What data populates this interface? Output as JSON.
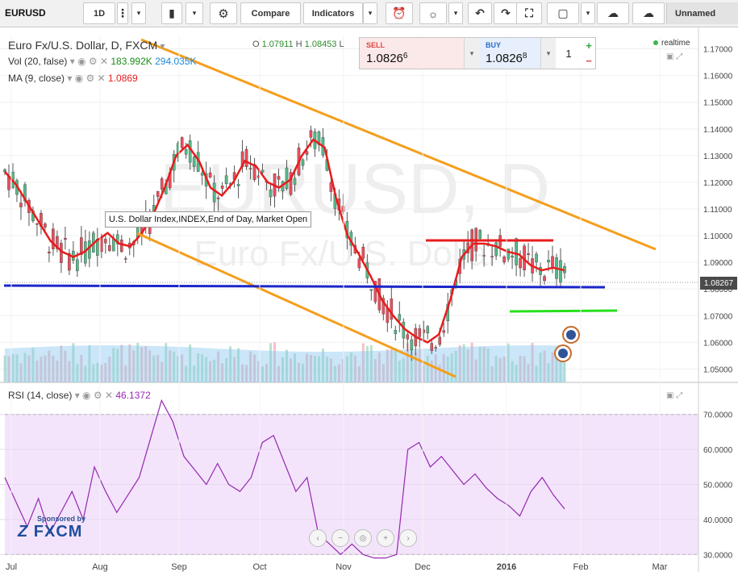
{
  "toolbar": {
    "symbol": "EURUSD",
    "interval": "1D",
    "compare": "Compare",
    "indicators": "Indicators",
    "layout_name": "Unnamed"
  },
  "legend": {
    "title": "Euro Fx/U.S. Dollar, D, FXCM",
    "open_label": "O",
    "open": "1.07911",
    "high_label": "H",
    "high": "1.08453",
    "low_label": "L",
    "vol_label": "Vol (20, false)",
    "vol_value": "183.992K",
    "vol_ma": "294.035K",
    "ma_label": "MA (9, close)",
    "ma_value": "1.0869",
    "rsi_label": "RSI (14, close)",
    "rsi_value": "46.1372"
  },
  "trade": {
    "sell_label": "SELL",
    "sell_price": "1.0826",
    "sell_pip": "6",
    "buy_label": "BUY",
    "buy_price": "1.0826",
    "buy_pip": "8",
    "quantity": "1",
    "plus": "+",
    "minus": "−"
  },
  "realtime": "realtime",
  "watermark": {
    "line1": "EURUSD, D",
    "line2": "Euro Fx/U.S. Dollar"
  },
  "tooltip": "U.S. Dollar Index,INDEX,End of Day, Market Open",
  "current_price": "1.08267",
  "sponsor": {
    "text": "Sponsored by",
    "brand": "FXCM"
  },
  "colors": {
    "up": "#53b987",
    "down": "#eb4d5c",
    "ma": "#e81c1c",
    "channel": "#f59e1c",
    "support": "#1b26c9",
    "green_line": "#26e01c",
    "resistance": "#e81c1c",
    "rsi": "#9528b0",
    "rsi_band": "#f3e4fb",
    "volume_ma": "#8cc7ef"
  },
  "chart_data": {
    "type": "candlestick",
    "price_axis": {
      "min": 1.045,
      "max": 1.175,
      "ticks": [
        "1.05000",
        "1.06000",
        "1.07000",
        "1.08000",
        "1.09000",
        "1.10000",
        "1.11000",
        "1.12000",
        "1.13000",
        "1.14000",
        "1.15000",
        "1.16000",
        "1.17000"
      ]
    },
    "rsi_axis": {
      "min": 25,
      "max": 78,
      "ticks": [
        "30.0000",
        "40.0000",
        "50.0000",
        "60.0000",
        "70.0000"
      ],
      "band": [
        30,
        70
      ]
    },
    "time_labels": [
      "Jul",
      "Aug",
      "Sep",
      "Oct",
      "Nov",
      "Dec",
      "2016",
      "Feb",
      "Mar"
    ],
    "ma_series": [
      1.124,
      1.119,
      1.112,
      1.105,
      1.098,
      1.094,
      1.092,
      1.094,
      1.098,
      1.101,
      1.097,
      1.096,
      1.101,
      1.108,
      1.118,
      1.13,
      1.134,
      1.128,
      1.118,
      1.115,
      1.12,
      1.128,
      1.126,
      1.12,
      1.118,
      1.121,
      1.13,
      1.136,
      1.133,
      1.114,
      1.1,
      1.093,
      1.085,
      1.076,
      1.07,
      1.065,
      1.062,
      1.06,
      1.063,
      1.076,
      1.092,
      1.097,
      1.097,
      1.096,
      1.094,
      1.093,
      1.089,
      1.087,
      1.088,
      1.087
    ],
    "rsi_series": [
      52,
      45,
      38,
      46,
      36,
      42,
      48,
      40,
      55,
      48,
      42,
      47,
      52,
      63,
      74,
      68,
      58,
      54,
      50,
      56,
      50,
      48,
      52,
      62,
      64,
      56,
      48,
      52,
      36,
      33,
      30,
      33,
      30,
      29,
      29,
      30,
      60,
      62,
      55,
      58,
      54,
      50,
      53,
      49,
      46,
      44,
      41,
      48,
      52,
      47,
      43
    ]
  }
}
